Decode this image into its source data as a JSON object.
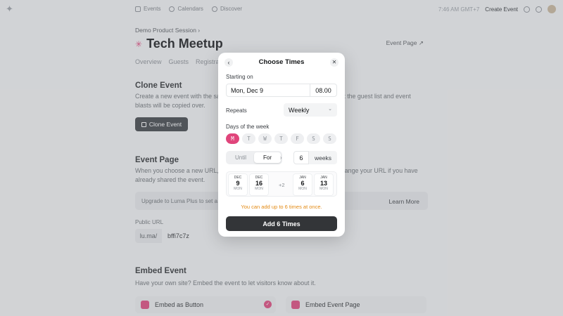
{
  "nav": {
    "links": [
      "Events",
      "Calendars",
      "Discover"
    ],
    "time": "7:46 AM GMT+7",
    "create": "Create Event"
  },
  "page": {
    "breadcrumb": "Demo Product Session ›",
    "title": "Tech Meetup",
    "event_page_link": "Event Page ↗",
    "tabs": [
      "Overview",
      "Guests",
      "Registration"
    ],
    "clone": {
      "heading": "Clone Event",
      "desc": "Create a new event with the same information as this one. Everything except the guest list and event blasts will be copied over.",
      "button": "Clone Event"
    },
    "event_page": {
      "heading": "Event Page",
      "desc": "When you choose a new URL, the current one will no longer work. Do not change your URL if you have already shared the event.",
      "upgrade": "Upgrade to Luma Plus to set a custom URL for this event.",
      "learn_more": "Learn More",
      "public_url_label": "Public URL",
      "url_prefix": "lu.ma/",
      "url_value": "bffi7c7z"
    },
    "embed": {
      "heading": "Embed Event",
      "desc": "Have your own site? Embed the event to let visitors know about it.",
      "option1": "Embed as Button",
      "option2": "Embed Event Page"
    }
  },
  "modal": {
    "title": "Choose Times",
    "starting_label": "Starting on",
    "start_date": "Mon, Dec 9",
    "start_time": "08.00",
    "repeats_label": "Repeats",
    "repeats_value": "Weekly",
    "days_label": "Days of the week",
    "days": [
      "M",
      "T",
      "W",
      "T",
      "F",
      "S",
      "S"
    ],
    "selected_day_index": 0,
    "until_label": "Until",
    "for_label": "For",
    "count": "6",
    "unit": "weeks",
    "dates": [
      {
        "month": "DEC",
        "day": "9",
        "weekday": "MON"
      },
      {
        "month": "DEC",
        "day": "16",
        "weekday": "MON"
      },
      {
        "month": "JAN",
        "day": "6",
        "weekday": "MON"
      },
      {
        "month": "JAN",
        "day": "13",
        "weekday": "MON"
      }
    ],
    "more": "+2",
    "warning": "You can add up to 6 times at once.",
    "add_button": "Add 6 Times",
    "accent": "#e0457b",
    "warning_color": "#e38a13"
  }
}
